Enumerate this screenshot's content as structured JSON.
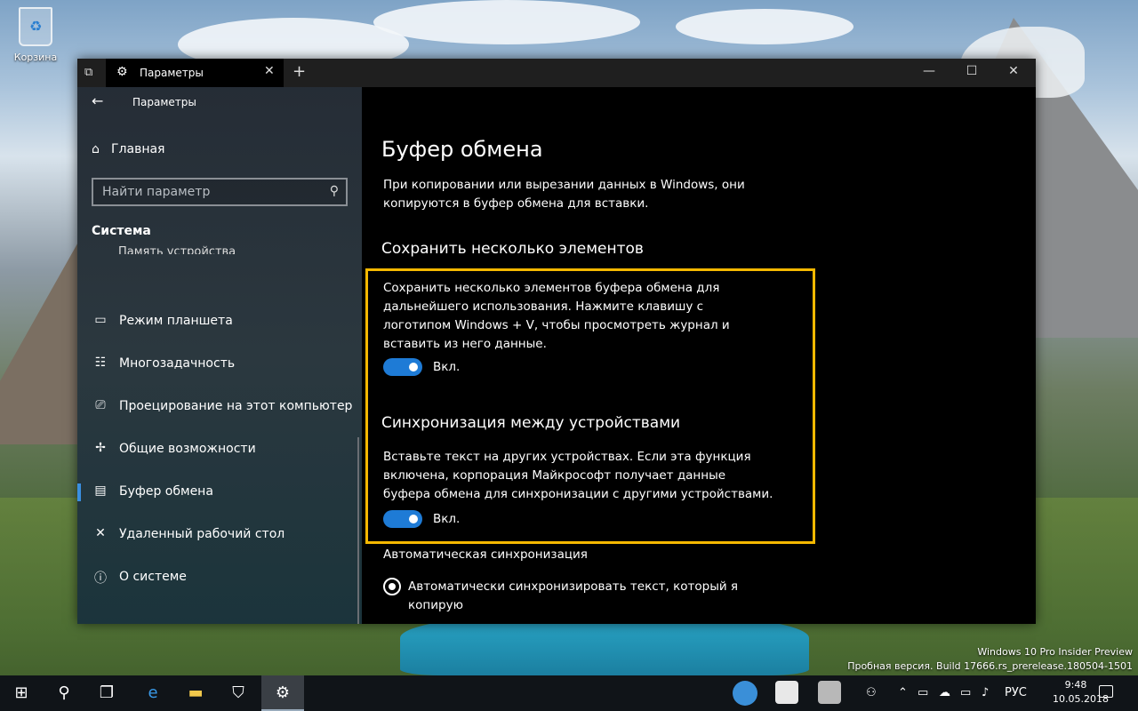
{
  "desktop": {
    "recycle_bin_label": "Корзина",
    "watermark_line1": "Windows 10 Pro Insider Preview",
    "watermark_line2": "Пробная версия. Build 17666.rs_prerelease.180504-1501"
  },
  "window": {
    "tab_title": "Параметры",
    "minimize": "—",
    "maximize": "☐",
    "close": "✕",
    "new_tab": "+"
  },
  "sidebar": {
    "back": "←",
    "app_title": "Параметры",
    "home_label": "Главная",
    "search_placeholder": "Найти параметр",
    "group_label": "Система",
    "cut_item": "Память устройства",
    "items": [
      {
        "label": "Режим планшета",
        "icon": "tablet-icon"
      },
      {
        "label": "Многозадачность",
        "icon": "multitask-icon"
      },
      {
        "label": "Проецирование на этот компьютер",
        "icon": "project-icon"
      },
      {
        "label": "Общие возможности",
        "icon": "share-icon"
      },
      {
        "label": "Буфер обмена",
        "icon": "clipboard-icon"
      },
      {
        "label": "Удаленный рабочий стол",
        "icon": "remote-icon"
      },
      {
        "label": "О системе",
        "icon": "info-icon"
      }
    ]
  },
  "content": {
    "title": "Буфер обмена",
    "intro": "При копировании или вырезании данных в Windows, они копируются в буфер обмена для вставки.",
    "save_heading": "Сохранить несколько элементов",
    "save_desc": "Сохранить несколько элементов буфера обмена для дальнейшего использования. Нажмите клавишу с логотипом Windows + V, чтобы просмотреть журнал и вставить из него данные.",
    "save_toggle_label": "Вкл.",
    "sync_heading": "Синхронизация между устройствами",
    "sync_desc": "Вставьте текст на других устройствах. Если эта функция включена, корпорация Майкрософт получает данные буфера обмена для синхронизации с другими устройствами.",
    "sync_toggle_label": "Вкл.",
    "auto_sync_label": "Автоматическая синхронизация",
    "auto_sync_option": "Автоматически синхронизировать текст, который я копирую"
  },
  "taskbar": {
    "lang": "РУС",
    "time": "9:48",
    "date": "10.05.2018"
  },
  "colors": {
    "accent": "#1e7bd6",
    "highlight": "#f5b800"
  }
}
